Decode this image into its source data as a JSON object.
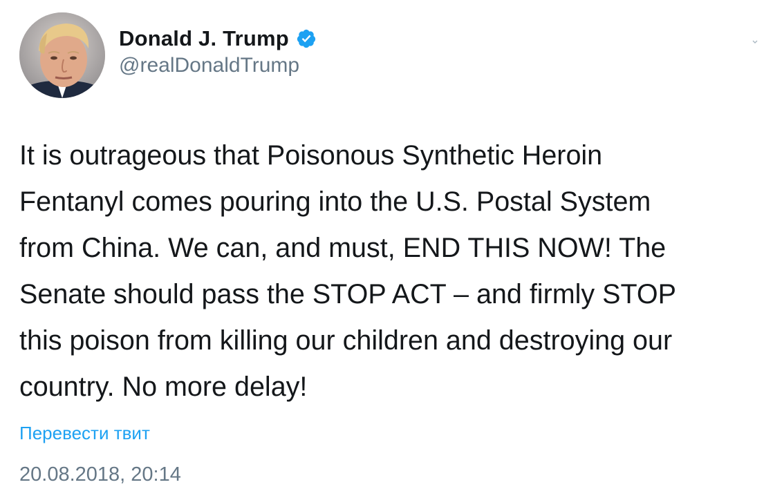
{
  "author": {
    "display_name": "Donald J. Trump",
    "handle": "@realDonaldTrump",
    "verified": true
  },
  "tweet": {
    "lines": [
      "It is outrageous that Poisonous Synthetic Heroin",
      "Fentanyl comes pouring into the U.S. Postal System",
      "from China. We can, and must, END THIS NOW! The",
      "Senate should pass the STOP ACT – and firmly STOP",
      "this poison from killing our children and destroying our",
      "country. No more delay!"
    ]
  },
  "translate_label": "Перевести твит",
  "timestamp": "20.08.2018, 20:14",
  "colors": {
    "accent": "#1da1f2",
    "muted": "#657786",
    "text": "#14171a"
  },
  "icons": {
    "verified": "verified-badge-icon",
    "caret": "chevron-down-icon"
  }
}
